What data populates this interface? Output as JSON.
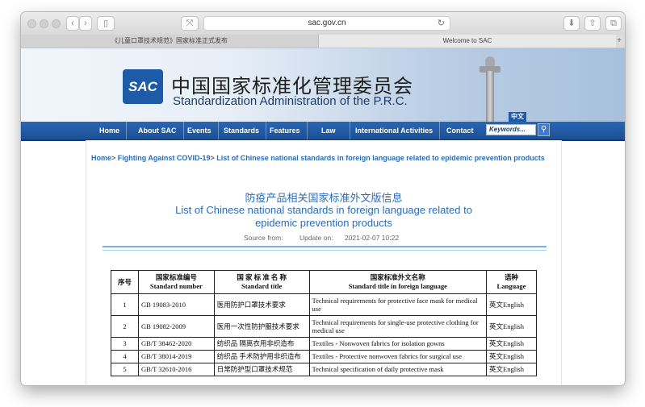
{
  "browser": {
    "url": "sac.gov.cn",
    "tabs": [
      {
        "label": "《儿童口罩技术规范》国家标准正式发布"
      },
      {
        "label": "Welcome to SAC"
      }
    ]
  },
  "header": {
    "logo_text": "SAC",
    "title_cn": "中国国家标准化管理委员会",
    "title_en": "Standardization Administration of the P.R.C.",
    "lang_badge": "中文"
  },
  "nav": {
    "items": [
      "Home",
      "About SAC",
      "Events",
      "Standards",
      "Features",
      "Law",
      "International Activities",
      "Contact"
    ],
    "search_placeholder": "Keywords..."
  },
  "breadcrumb": {
    "home": "Home",
    "section": "Fighting Against COVID-19",
    "current": "List of Chinese national standards in foreign language related to epidemic prevention products"
  },
  "article": {
    "title_cn": "防疫产品相关国家标准外文版信息",
    "title_en": "List of Chinese national standards in foreign language related to epidemic prevention products",
    "source_label": "Source from:",
    "update_label": "Update on:",
    "update_value": "2021-02-07 10:22"
  },
  "table": {
    "headers": [
      {
        "cn": "序号",
        "en": ""
      },
      {
        "cn": "国家标准编号",
        "en": "Standard number"
      },
      {
        "cn": "国 家 标 准 名 称",
        "en": "Standard title"
      },
      {
        "cn": "国家标准外文名称",
        "en": "Standard title in foreign language"
      },
      {
        "cn": "语种",
        "en": "Language"
      }
    ],
    "rows": [
      {
        "no": "1",
        "number": "GB 19083-2010",
        "title": "医用防护口罩技术要求",
        "title_en": "Technical requirements for protective face mask for medical use",
        "lang": "英文English"
      },
      {
        "no": "2",
        "number": "GB 19082-2009",
        "title": "医用一次性防护服技术要求",
        "title_en": "Technical requirements for single-use protective clothing for medical use",
        "lang": "英文English"
      },
      {
        "no": "3",
        "number": "GB/T 38462-2020",
        "title": "纺织品 隔离衣用非织造布",
        "title_en": "Textiles - Nonwoven fabrics for isolation gowns",
        "lang": "英文English"
      },
      {
        "no": "4",
        "number": "GB/T 38014-2019",
        "title": "纺织品 手术防护用非织造布",
        "title_en": "Textiles - Protective nonwoven fabrics for surgical use",
        "lang": "英文English"
      },
      {
        "no": "5",
        "number": "GB/T 32610-2016",
        "title": "日常防护型口罩技术规范",
        "title_en": "Technical specification of daily protective mask",
        "lang": "英文English"
      }
    ]
  }
}
